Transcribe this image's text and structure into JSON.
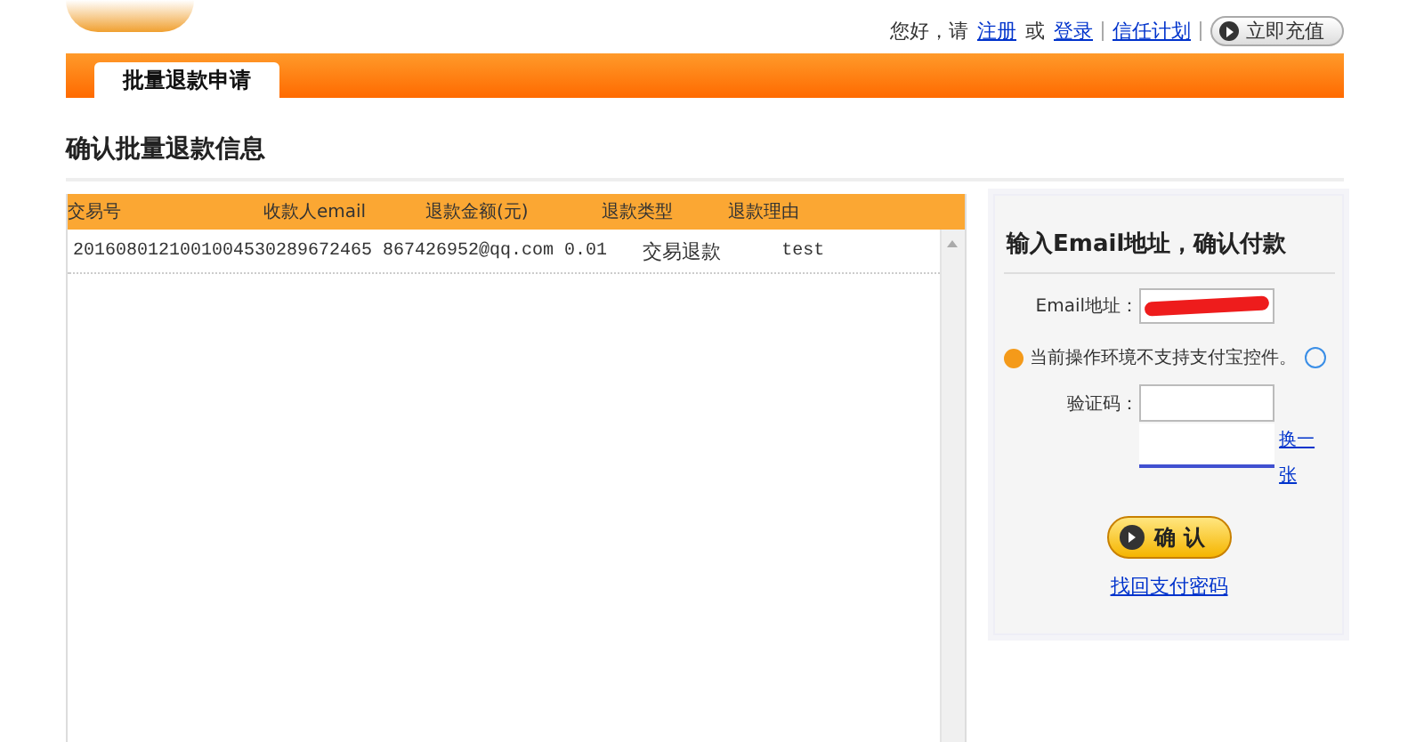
{
  "header": {
    "greeting": "您好，请",
    "links": [
      {
        "label": "注册"
      },
      {
        "label": "或",
        "kind": "text"
      },
      {
        "label": "登录"
      },
      {
        "label": "信任计划",
        "kind": "separated"
      }
    ],
    "recharge_button": "立即充值"
  },
  "tabs": [
    {
      "label": "批量退款申请",
      "selected": true
    }
  ],
  "section_title": "确认批量退款信息",
  "table": {
    "columns": [
      "交易号",
      "收款人email",
      "退款金额(元)",
      "退款类型",
      "退款理由"
    ],
    "rows": [
      {
        "trade_no": "2016080121001004530289672465",
        "email": "867426952@qq.com",
        "amount": "0.01",
        "type": "交易退款",
        "reason": "test"
      }
    ]
  },
  "payment_panel": {
    "title": "输入Email地址，确认付款",
    "email_label": "Email地址：",
    "notice": "当前操作环境不支持支付宝控件。",
    "captcha_label": "验证码：",
    "captcha_refresh": "换一张",
    "confirm_button": "确 认",
    "recover_link": "找回支付密码"
  }
}
